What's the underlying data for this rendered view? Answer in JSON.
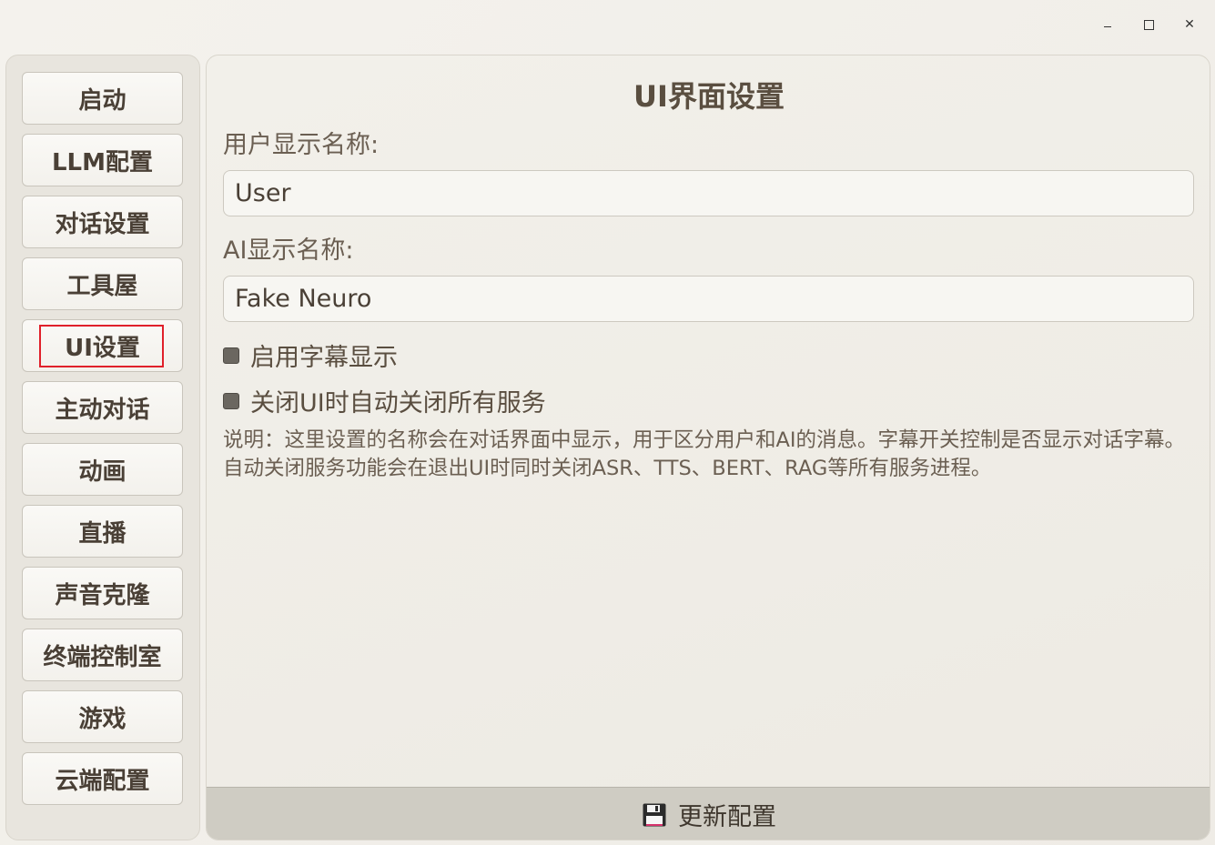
{
  "window": {
    "minimize_icon": "minimize-icon",
    "maximize_icon": "maximize-icon",
    "close_label": "✕"
  },
  "sidebar": {
    "items": [
      {
        "label": "启动"
      },
      {
        "label": "LLM配置"
      },
      {
        "label": "对话设置"
      },
      {
        "label": "工具屋"
      },
      {
        "label": "UI设置",
        "active": true
      },
      {
        "label": "主动对话"
      },
      {
        "label": "动画"
      },
      {
        "label": "直播"
      },
      {
        "label": "声音克隆"
      },
      {
        "label": "终端控制室"
      },
      {
        "label": "游戏"
      },
      {
        "label": "云端配置"
      }
    ],
    "highlight_color": "#e0202a"
  },
  "main": {
    "title": "UI界面设置",
    "user_name": {
      "label": "用户显示名称:",
      "value": "User"
    },
    "ai_name": {
      "label": "AI显示名称:",
      "value": "Fake Neuro"
    },
    "checkboxes": [
      {
        "label": "启用字幕显示",
        "checked": false
      },
      {
        "label": "关闭UI时自动关闭所有服务",
        "checked": false
      }
    ],
    "note": "说明：这里设置的名称会在对话界面中显示，用于区分用户和AI的消息。字幕开关控制是否显示对话字幕。自动关闭服务功能会在退出UI时同时关闭ASR、TTS、BERT、RAG等所有服务进程。",
    "update_button": {
      "label": "更新配置",
      "icon": "floppy-disk-icon"
    }
  }
}
